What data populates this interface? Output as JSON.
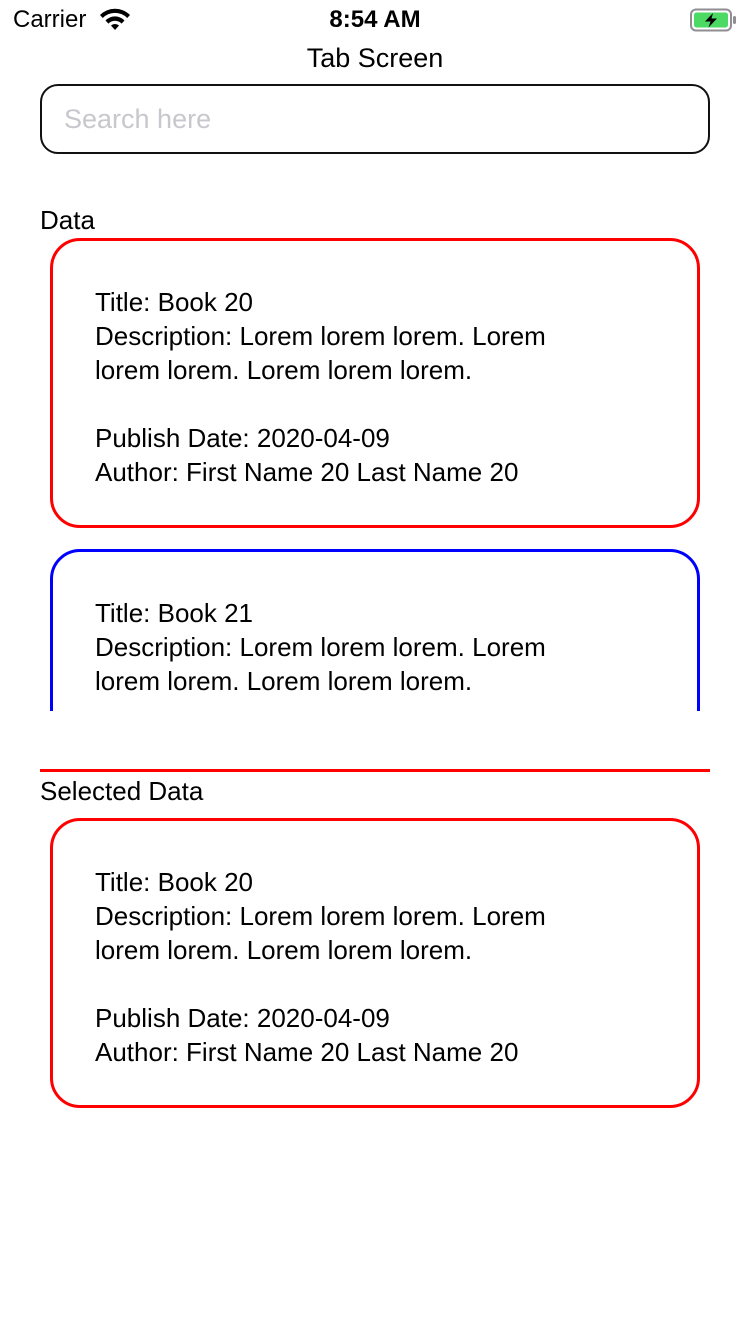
{
  "status_bar": {
    "carrier": "Carrier",
    "time": "8:54 AM",
    "wifi_icon": "wifi-icon",
    "battery_icon": "battery-charging-icon",
    "battery_color": "#4cd964"
  },
  "header": {
    "title": "Tab Screen"
  },
  "search": {
    "placeholder": "Search here",
    "value": ""
  },
  "data_section": {
    "label": "Data",
    "items": [
      {
        "title": "Title: Book 20",
        "description_line1": "Description: Lorem lorem lorem. Lorem",
        "description_line2": "lorem lorem. Lorem lorem lorem.",
        "publish_date": "Publish Date: 2020-04-09",
        "author": "Author: First Name 20 Last Name 20",
        "border_color": "#ff0000"
      },
      {
        "title": "Title: Book 21",
        "description_line1": "Description: Lorem lorem lorem. Lorem",
        "description_line2": "lorem lorem. Lorem lorem lorem.",
        "border_color": "#0000ff"
      }
    ]
  },
  "selected_section": {
    "label": "Selected Data",
    "item": {
      "title": "Title: Book 20",
      "description_line1": "Description: Lorem lorem lorem. Lorem",
      "description_line2": "lorem lorem. Lorem lorem lorem.",
      "publish_date": "Publish Date: 2020-04-09",
      "author": "Author: First Name 20 Last Name 20",
      "border_color": "#ff0000"
    }
  },
  "colors": {
    "selected_border": "#ff0000",
    "unselected_border": "#0000ff",
    "divider": "#ff0000",
    "placeholder": "#c7c7cd"
  }
}
